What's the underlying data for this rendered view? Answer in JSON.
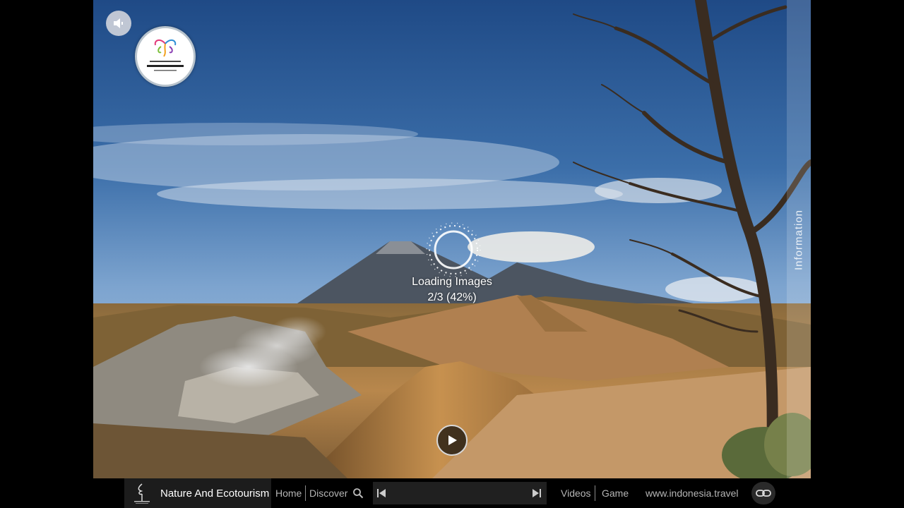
{
  "loading": {
    "line1": "Loading Images",
    "line2": "2/3 (42%)"
  },
  "info_tab": {
    "label": "Information"
  },
  "logo": {
    "alt": "wonderful indonesia"
  },
  "bottom_bar": {
    "title": "Nature And Ecotourism",
    "home": "Home",
    "discover": "Discover",
    "videos": "Videos",
    "game": "Game",
    "website": "www.indonesia.travel"
  },
  "icons": {
    "sound": "speaker-icon",
    "play": "play-icon",
    "search": "search-icon",
    "prev": "skip-previous-icon",
    "next": "skip-next-icon",
    "link": "link-icon"
  }
}
